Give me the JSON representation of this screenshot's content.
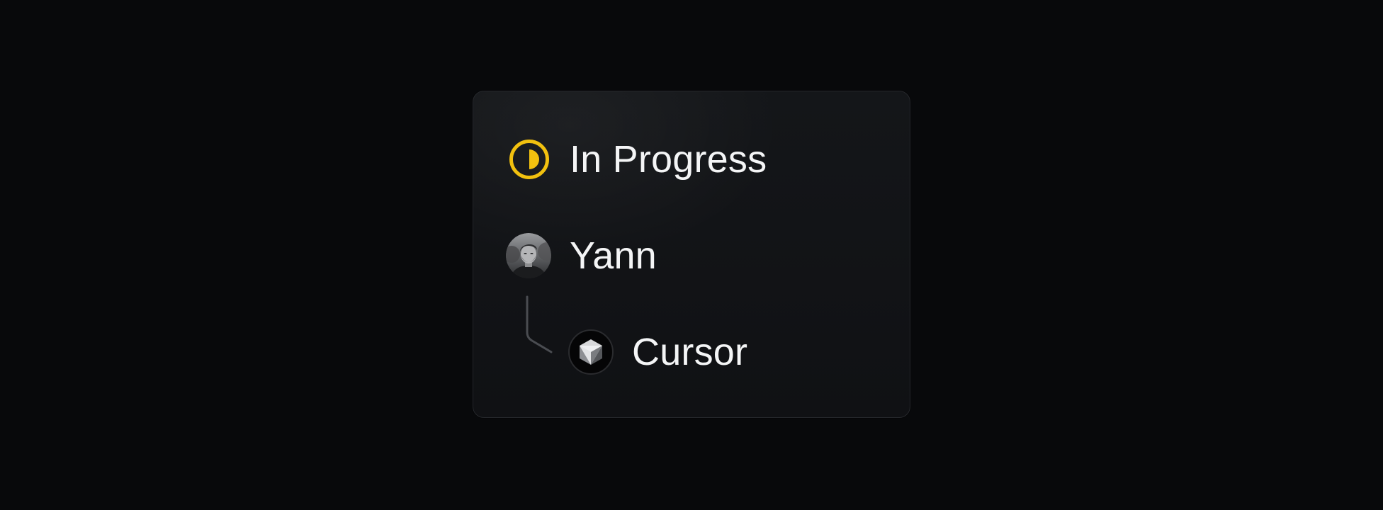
{
  "status": {
    "label": "In Progress",
    "icon": "half-filled-circle-icon",
    "color": "#f2c10f"
  },
  "assignee": {
    "name": "Yann",
    "avatar": "person-photo-avatar"
  },
  "agent": {
    "name": "Cursor",
    "icon": "cursor-cube-logo-icon"
  },
  "colors": {
    "background": "#08090b",
    "card": "#121316",
    "card_border": "#26282c",
    "text": "#f4f5f6",
    "connector": "#4a4c51"
  }
}
